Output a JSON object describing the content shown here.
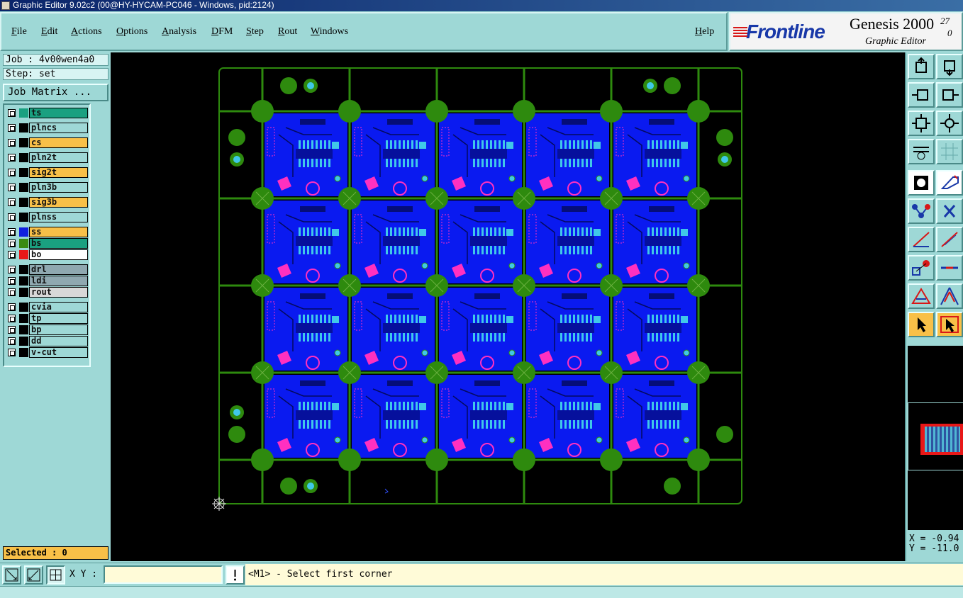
{
  "window": {
    "title": "Graphic Editor 9.02c2 (00@HY-HYCAM-PC046 - Windows, pid:2124)"
  },
  "menu": {
    "items": [
      "File",
      "Edit",
      "Actions",
      "Options",
      "Analysis",
      "DFM",
      "Step",
      "Rout",
      "Windows"
    ],
    "help": "Help"
  },
  "brand": {
    "logo": "Frontline",
    "product": "Genesis 2000",
    "superscript": "27",
    "superscript2": "0",
    "subtitle": "Graphic Editor"
  },
  "job": {
    "job_label": "Job : 4v00wen4a0",
    "step_label": "Step: set",
    "matrix_button": "Job Matrix ..."
  },
  "layers": [
    {
      "name": "ts",
      "color": "#1aa080",
      "swatch": "#1aa080"
    },
    {
      "name": "plncs",
      "color": "#9ed8d6",
      "swatch": "#000000"
    },
    {
      "name": "cs",
      "color": "#f8c048",
      "swatch": "#000000"
    },
    {
      "name": "pln2t",
      "color": "#9ed8d6",
      "swatch": "#000000"
    },
    {
      "name": "sig2t",
      "color": "#f8c048",
      "swatch": "#000000"
    },
    {
      "name": "pln3b",
      "color": "#9ed8d6",
      "swatch": "#000000"
    },
    {
      "name": "sig3b",
      "color": "#f8c048",
      "swatch": "#000000"
    },
    {
      "name": "plnss",
      "color": "#9ed8d6",
      "swatch": "#000000"
    },
    {
      "name": "ss",
      "color": "#f8c048",
      "swatch": "#1020e0"
    },
    {
      "name": "bs",
      "color": "#1aa080",
      "swatch": "#3a8a10"
    },
    {
      "name": "bo",
      "color": "#ffffff",
      "swatch": "#e81818"
    },
    {
      "name": "drl",
      "color": "#8fa8b0",
      "swatch": "#000000"
    },
    {
      "name": "ldi",
      "color": "#8fa8b0",
      "swatch": "#000000"
    },
    {
      "name": "rout",
      "color": "#d8d8d8",
      "swatch": "#000000"
    },
    {
      "name": "cvia",
      "color": "#9ed8d6",
      "swatch": "#000000"
    },
    {
      "name": "tp",
      "color": "#9ed8d6",
      "swatch": "#000000"
    },
    {
      "name": "bp",
      "color": "#9ed8d6",
      "swatch": "#000000"
    },
    {
      "name": "dd",
      "color": "#9ed8d6",
      "swatch": "#000000"
    },
    {
      "name": "v-cut",
      "color": "#9ed8d6",
      "swatch": "#000000"
    }
  ],
  "selected": "Selected : 0",
  "coords": {
    "x": "X = -0.94",
    "y": "Y = -11.0"
  },
  "status": {
    "xy_label": "X Y :",
    "xy_value": "",
    "message": "<M1> - Select first corner"
  },
  "colors": {
    "board_fill": "#0a1af0",
    "frame_green": "#2e8a0e",
    "pad_cyan": "#40c8e8",
    "magenta": "#ff30c0",
    "panel_bg": "#9ed8d6"
  }
}
